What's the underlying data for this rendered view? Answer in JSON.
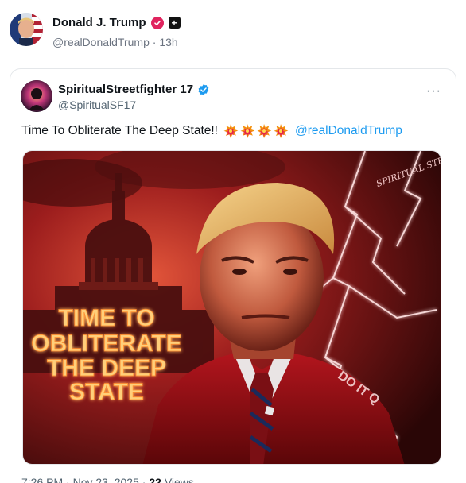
{
  "top_post": {
    "name": "Donald J. Trump",
    "handle": "@realDonaldTrump",
    "separator": "·",
    "time": "13h",
    "verified_color": "#e0245e"
  },
  "embedded_post": {
    "name": "SpiritualStreetfighter 17",
    "handle": "@SpiritualSF17",
    "text": "Time To Obliterate The Deep State!!",
    "emoji": "💥💥💥💥",
    "mention": "@realDonaldTrump",
    "more_label": "···",
    "image": {
      "overlay_text": [
        "TIME TO",
        "OBLITERATE",
        "THE DEEP",
        "STATE"
      ],
      "watermark": "SPIRITUAL STREETFIGHTER",
      "side_text": "DO IT Q"
    },
    "meta": {
      "time": "7:26 PM",
      "date": "Nov 23, 2025",
      "views_count": "22",
      "views_label": "Views"
    },
    "verified_color": "#1d9bf0",
    "mention_color": "#1d9bf0"
  }
}
